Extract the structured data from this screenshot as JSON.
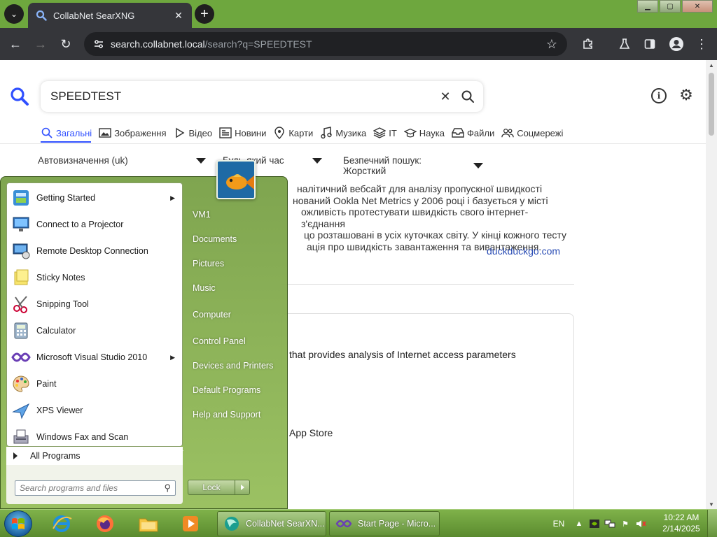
{
  "browser": {
    "tab": {
      "title": "CollabNet SearXNG"
    },
    "omnibox": {
      "host": "search.collabnet.local",
      "path": "/search?q=SPEEDTEST"
    }
  },
  "search": {
    "query": "SPEEDTEST",
    "categories": [
      {
        "label": "Загальні",
        "icon": "search-icon",
        "active": true
      },
      {
        "label": "Зображення",
        "icon": "image-icon"
      },
      {
        "label": "Відео",
        "icon": "play-icon"
      },
      {
        "label": "Новини",
        "icon": "newspaper-icon"
      },
      {
        "label": "Карти",
        "icon": "map-pin-icon"
      },
      {
        "label": "Музика",
        "icon": "music-note-icon"
      },
      {
        "label": "IT",
        "icon": "layers-icon"
      },
      {
        "label": "Наука",
        "icon": "graduation-cap-icon"
      },
      {
        "label": "Файли",
        "icon": "inbox-icon"
      },
      {
        "label": "Соцмережі",
        "icon": "people-icon"
      }
    ],
    "filters": {
      "language": "Автовизначення (uk)",
      "time": "Будь-який час",
      "safe_search": "Безпечний пошук: Жорсткий"
    }
  },
  "result": {
    "lines": [
      "налітичний вебсайт для аналізу пропускної швидкості",
      "нований Ookla Net Metrics у 2006 році і базується у місті",
      "ожливість протестувати швидкість свого інтернет-з'єднання",
      "цо розташовані в усіх куточках світу. У кінці кожного тесту",
      "ація про швидкість завантаження та вивантаження."
    ],
    "source": "duckduckgo.com"
  },
  "infobox": {
    "line1": "that provides analysis of Internet access parameters",
    "line2": "App Store"
  },
  "start_menu": {
    "programs": [
      {
        "label": "Getting Started",
        "icon": "getting-started-icon",
        "submenu": true
      },
      {
        "label": "Connect to a Projector",
        "icon": "projector-icon",
        "submenu": false
      },
      {
        "label": "Remote Desktop Connection",
        "icon": "remote-desktop-icon",
        "submenu": false
      },
      {
        "label": "Sticky Notes",
        "icon": "sticky-notes-icon",
        "submenu": false
      },
      {
        "label": "Snipping Tool",
        "icon": "scissors-icon",
        "submenu": false
      },
      {
        "label": "Calculator",
        "icon": "calculator-icon",
        "submenu": false
      },
      {
        "label": "Microsoft Visual Studio 2010",
        "icon": "visual-studio-icon",
        "submenu": true
      },
      {
        "label": "Paint",
        "icon": "paint-palette-icon",
        "submenu": false
      },
      {
        "label": "XPS Viewer",
        "icon": "xps-viewer-icon",
        "submenu": false
      },
      {
        "label": "Windows Fax and Scan",
        "icon": "fax-icon",
        "submenu": false
      }
    ],
    "all_programs": "All Programs",
    "search_placeholder": "Search programs and files",
    "right_items": [
      "VM1",
      "Documents",
      "Pictures",
      "Music",
      "Computer",
      "Control Panel",
      "Devices and Printers",
      "Default Programs",
      "Help and Support"
    ],
    "lock_label": "Lock"
  },
  "taskbar": {
    "tasks": [
      {
        "label": "CollabNet SearXN...",
        "icon": "chrome-icon",
        "active": true
      },
      {
        "label": "Start Page - Micro...",
        "icon": "visual-studio-icon",
        "active": false
      }
    ],
    "language": "EN",
    "time": "10:22 AM",
    "date": "2/14/2025"
  },
  "colors": {
    "accent": "#3050ff",
    "link": "#2a4db5",
    "titlebar": "#6ea73e",
    "chrome_dark": "#35363a"
  }
}
